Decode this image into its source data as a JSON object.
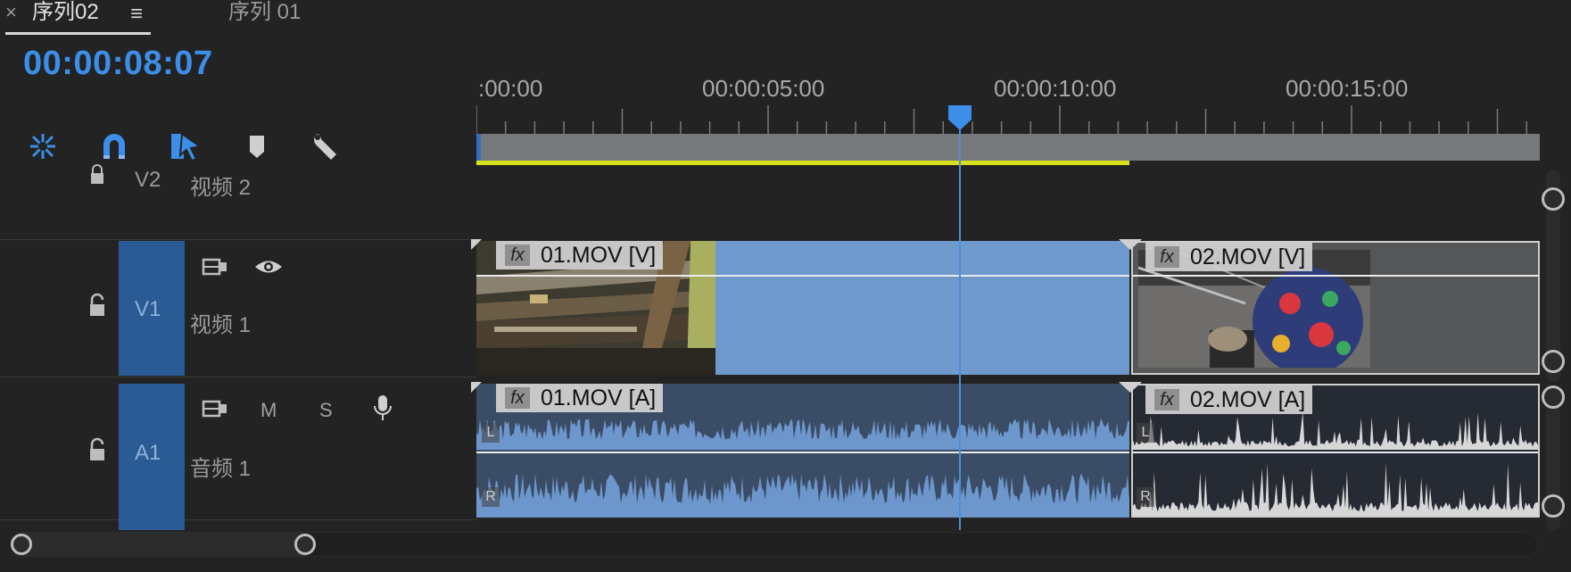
{
  "tabs": {
    "close_symbol": "×",
    "active": "序列02",
    "menu_symbol": "≡",
    "inactive": "序列 01"
  },
  "timecode": "00:00:08:07",
  "ruler": {
    "labels": [
      ":00:00",
      "00:00:05:00",
      "00:00:10:00",
      "00:00:15:00"
    ]
  },
  "tools": [
    "ripple-edit-icon",
    "snap-magnet-icon",
    "linked-selection-icon",
    "add-marker-icon",
    "settings-wrench-icon"
  ],
  "tracks": {
    "v2": {
      "id": "V2",
      "name": "视频 2"
    },
    "v1": {
      "id": "V1",
      "name": "视频 1"
    },
    "a1": {
      "id": "A1",
      "name": "音频 1",
      "mute": "M",
      "solo": "S"
    }
  },
  "clips": {
    "v1a": {
      "title": "01.MOV [V]",
      "fx": "fx"
    },
    "v1b": {
      "title": "02.MOV [V]",
      "fx": "fx"
    },
    "a1a": {
      "title": "01.MOV [A]",
      "fx": "fx",
      "left": "L",
      "right": "R"
    },
    "a1b": {
      "title": "02.MOV [A]",
      "fx": "fx",
      "left": "L",
      "right": "R"
    }
  },
  "colors": {
    "accent": "#3c8ee8",
    "track_header": "#2b5b95",
    "clip_blue": "#6d97cc",
    "render_bar": "#d7e21b"
  }
}
